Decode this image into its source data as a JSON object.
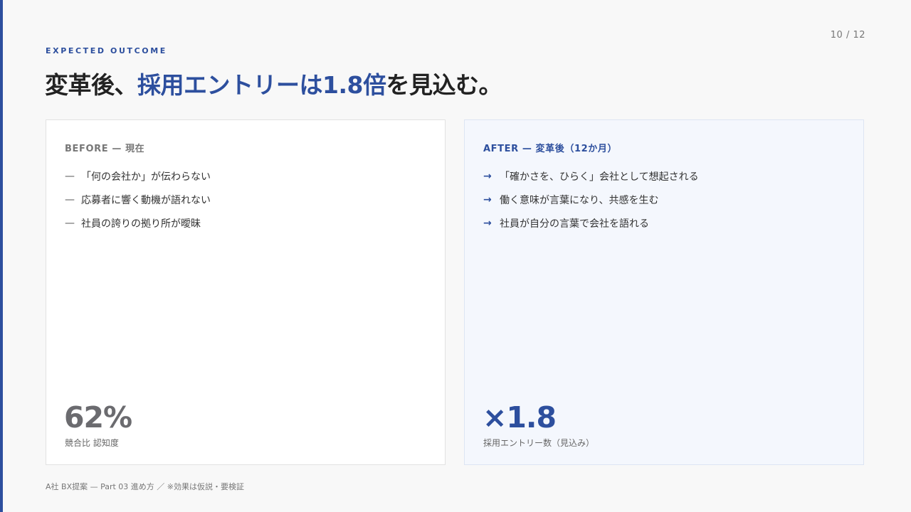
{
  "page_number": "10 / 12",
  "eyebrow": "EXPECTED OUTCOME",
  "headline": {
    "prefix": "変革後、",
    "accent": "採用エントリーは1.8倍",
    "suffix": "を見込む。"
  },
  "before": {
    "label": "BEFORE — 現在",
    "marker": "—",
    "items": [
      "「何の会社か」が伝わらない",
      "応募者に響く動機が語れない",
      "社員の誇りの拠り所が曖昧"
    ],
    "stat_value": "62%",
    "stat_caption": "競合比 認知度"
  },
  "after": {
    "label": "AFTER — 変革後（12か月）",
    "marker": "→",
    "items": [
      "「確かさを、ひらく」会社として想起される",
      "働く意味が言葉になり、共感を生む",
      "社員が自分の言葉で会社を語れる"
    ],
    "stat_value": "×1.8",
    "stat_caption": "採用エントリー数（見込み）"
  },
  "footer": "A社 BX提案 — Part 03 進め方 ／ ※効果は仮説・要検証",
  "colors": {
    "accent": "#2d4f9e",
    "background": "#f8f8f8",
    "after_card_bg": "#f4f7fd"
  }
}
